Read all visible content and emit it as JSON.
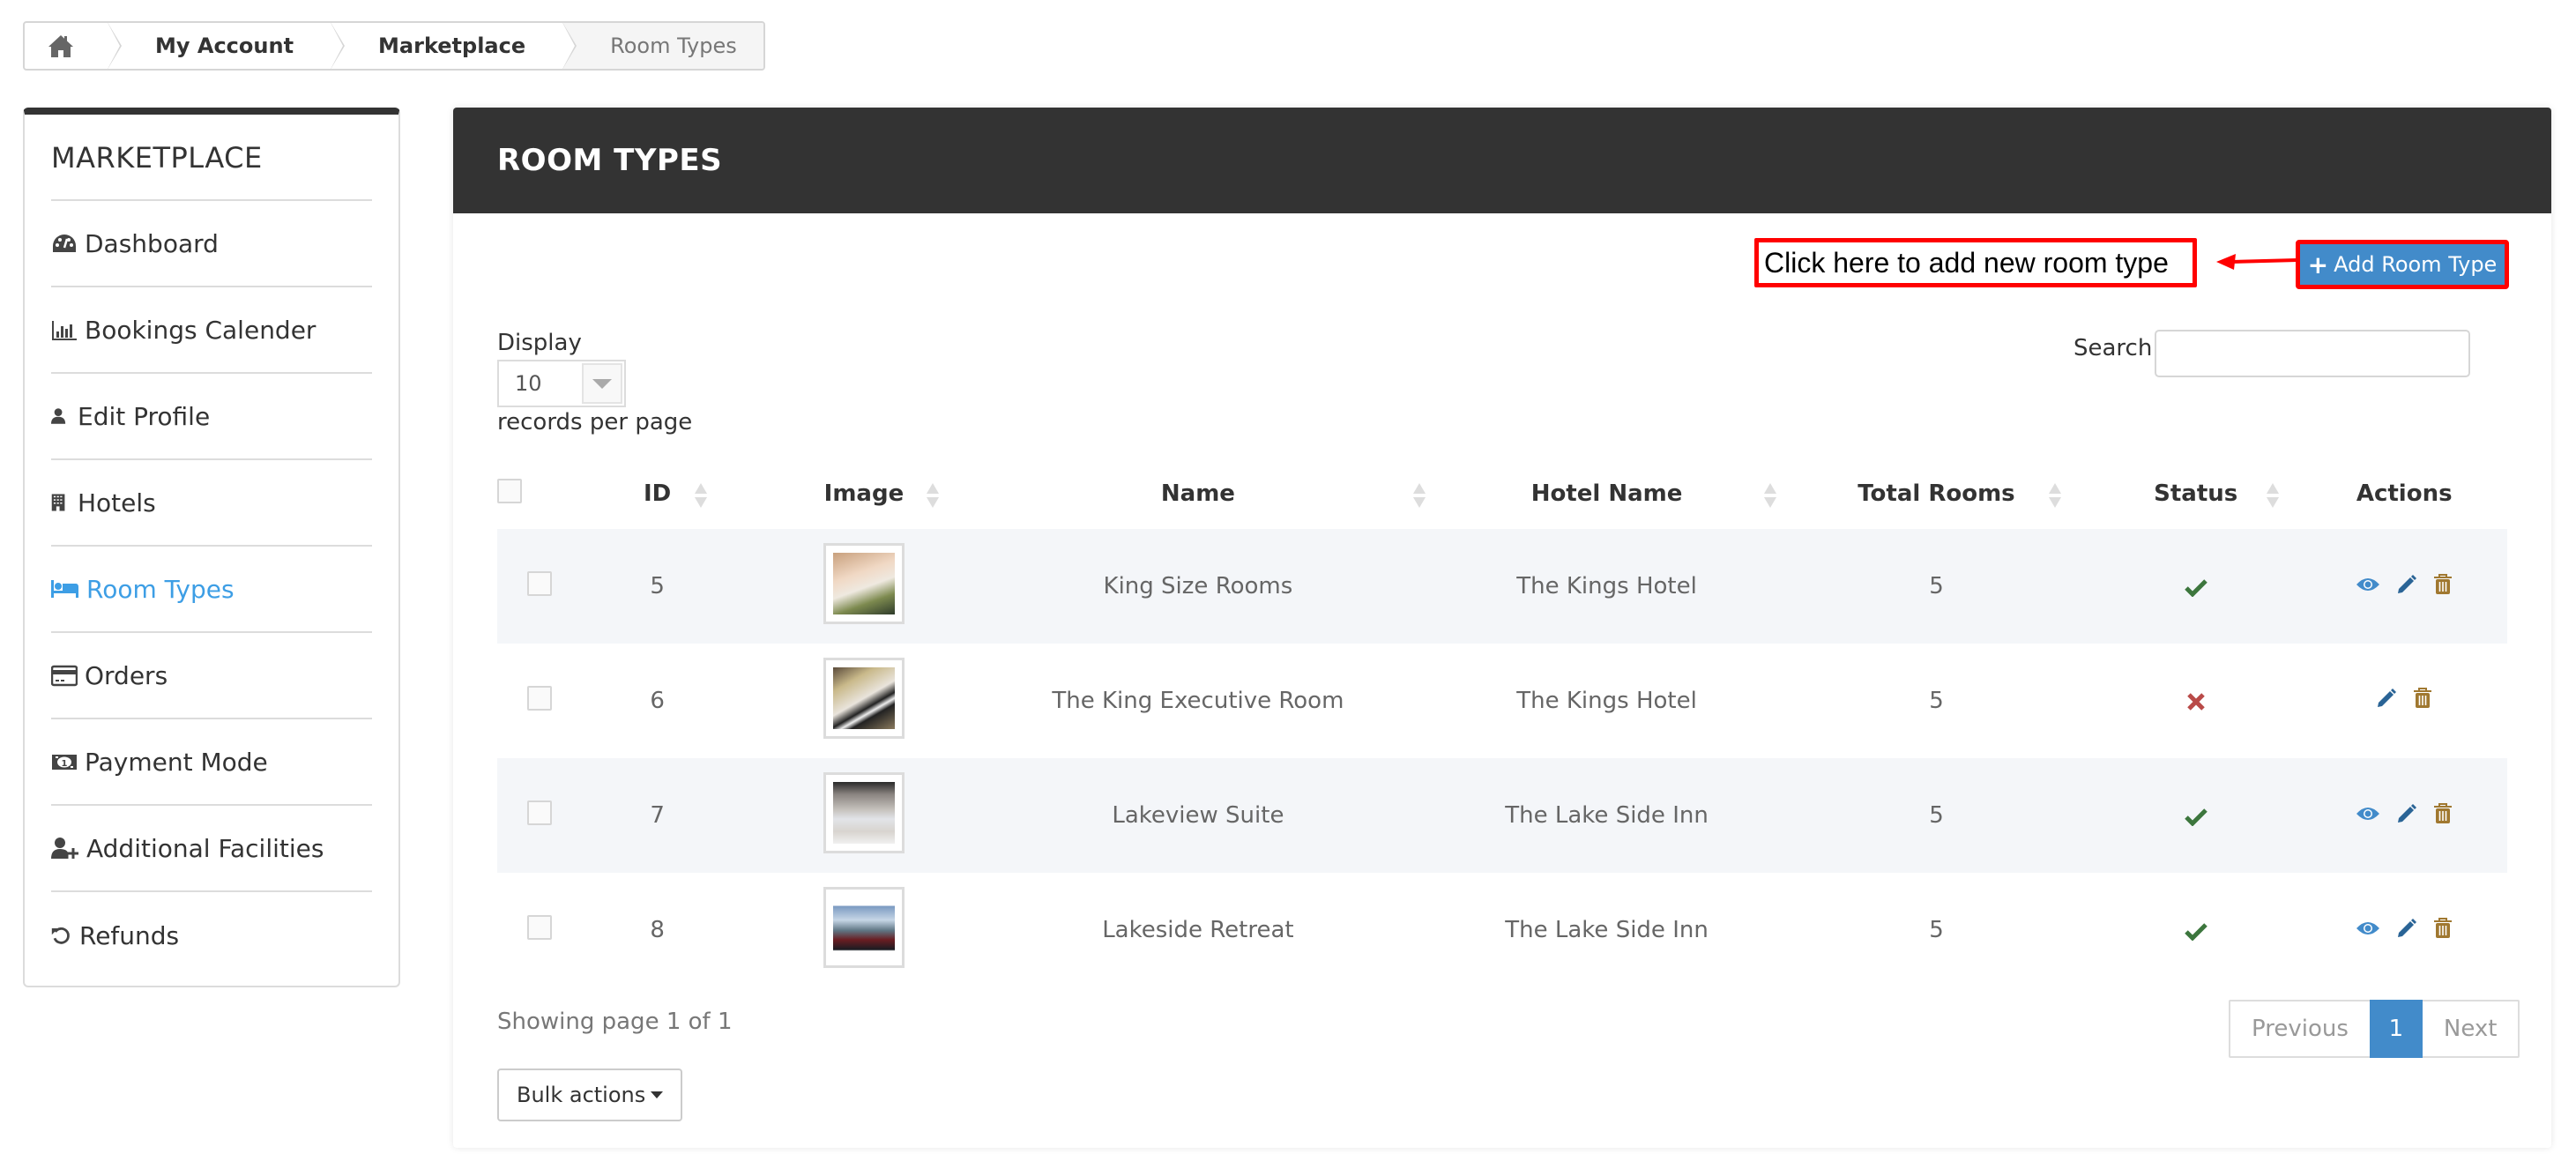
{
  "breadcrumb": {
    "home_icon": "home-icon",
    "items": [
      "My Account",
      "Marketplace",
      "Room Types"
    ]
  },
  "sidebar": {
    "title": "MARKETPLACE",
    "active_color": "#3d9ee5",
    "items": [
      {
        "label": "Dashboard",
        "icon": "dashboard-icon"
      },
      {
        "label": "Bookings Calender",
        "icon": "bar-chart-icon"
      },
      {
        "label": "Edit Profile",
        "icon": "user-icon"
      },
      {
        "label": "Hotels",
        "icon": "building-icon"
      },
      {
        "label": "Room Types",
        "icon": "bed-icon",
        "active": true
      },
      {
        "label": "Orders",
        "icon": "credit-card-icon"
      },
      {
        "label": "Payment Mode",
        "icon": "money-icon"
      },
      {
        "label": "Additional Facilities",
        "icon": "user-plus-icon"
      },
      {
        "label": "Refunds",
        "icon": "undo-icon"
      }
    ]
  },
  "panel": {
    "title": "ROOM TYPES",
    "annotation": "Click here to add new room type",
    "add_button": "Add Room Type",
    "display_label": "Display",
    "display_value": "10",
    "records_per_page": "records per page",
    "search_label": "Search",
    "search_value": ""
  },
  "table": {
    "columns": [
      "ID",
      "Image",
      "Name",
      "Hotel Name",
      "Total Rooms",
      "Status",
      "Actions"
    ],
    "rows": [
      {
        "id": "5",
        "name": "King Size Rooms",
        "hotel": "The Kings Hotel",
        "total_rooms": "5",
        "status": "active",
        "actions": [
          "view",
          "edit",
          "delete"
        ]
      },
      {
        "id": "6",
        "name": "The King Executive Room",
        "hotel": "The Kings Hotel",
        "total_rooms": "5",
        "status": "inactive",
        "actions": [
          "edit",
          "delete"
        ]
      },
      {
        "id": "7",
        "name": "Lakeview Suite",
        "hotel": "The Lake Side Inn",
        "total_rooms": "5",
        "status": "active",
        "actions": [
          "view",
          "edit",
          "delete"
        ]
      },
      {
        "id": "8",
        "name": "Lakeside Retreat",
        "hotel": "The Lake Side Inn",
        "total_rooms": "5",
        "status": "active",
        "actions": [
          "view",
          "edit",
          "delete"
        ]
      }
    ]
  },
  "footer": {
    "showing": "Showing page 1 of 1",
    "bulk_actions": "Bulk actions",
    "pagination": {
      "previous": "Previous",
      "current": "1",
      "next": "Next"
    }
  },
  "colors": {
    "header_bg": "#333333",
    "primary": "#428bca",
    "annotation": "#ff0000",
    "status_ok": "#3c763d",
    "status_off": "#b94a48",
    "view": "#428bca",
    "edit": "#2a6496",
    "delete": "#a07830"
  }
}
